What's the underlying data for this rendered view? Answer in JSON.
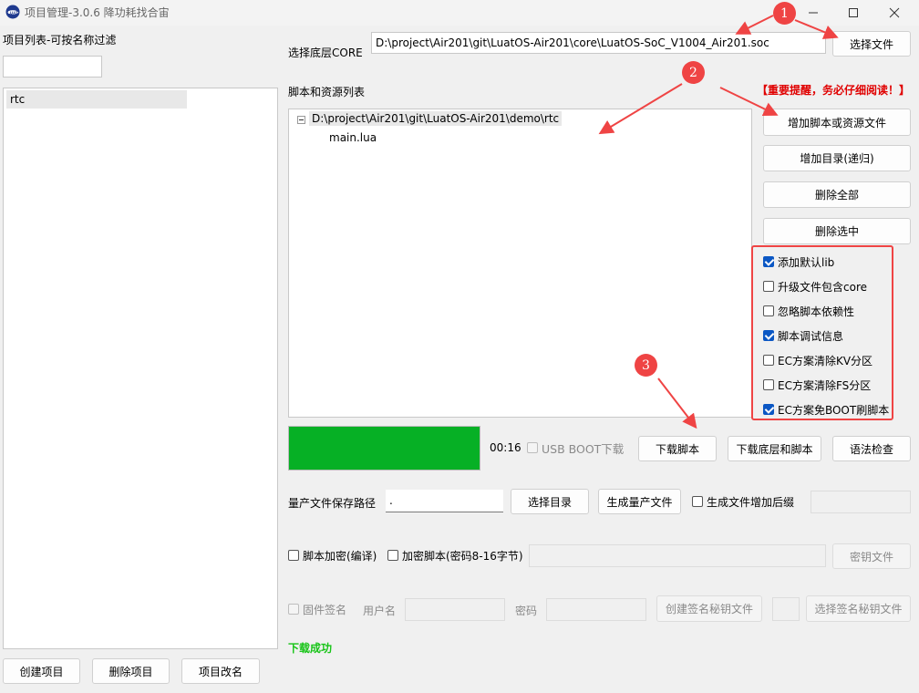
{
  "window": {
    "title": "项目管理-3.0.6 降功耗找合宙"
  },
  "left_panel": {
    "header": "项目列表-可按名称过滤",
    "filter_value": "",
    "projects": [
      "rtc"
    ],
    "buttons": {
      "create": "创建项目",
      "delete": "删除项目",
      "rename": "项目改名"
    }
  },
  "core": {
    "label": "选择底层CORE",
    "path": "D:\\project\\Air201\\git\\LuatOS-Air201\\core\\LuatOS-SoC_V1004_Air201.soc",
    "choose_button": "选择文件"
  },
  "scripts": {
    "label": "脚本和资源列表",
    "warning": "【重要提醒，务必仔细阅读！】",
    "tree_root": "D:\\project\\Air201\\git\\LuatOS-Air201\\demo\\rtc",
    "tree_children": [
      "main.lua"
    ],
    "buttons": {
      "add_files": "增加脚本或资源文件",
      "add_dir": "增加目录(递归)",
      "delete_all": "删除全部",
      "delete_selected": "删除选中"
    }
  },
  "options": [
    {
      "label": "添加默认lib",
      "checked": true
    },
    {
      "label": "升级文件包含core",
      "checked": false
    },
    {
      "label": "忽略脚本依赖性",
      "checked": false
    },
    {
      "label": "脚本调试信息",
      "checked": true
    },
    {
      "label": "EC方案清除KV分区",
      "checked": false
    },
    {
      "label": "EC方案清除FS分区",
      "checked": false
    },
    {
      "label": "EC方案免BOOT刷脚本",
      "checked": true
    }
  ],
  "download": {
    "progress": 1.0,
    "progress_color": "#06b025",
    "elapsed": "00:16",
    "usb_boot_label": "USB BOOT下载",
    "buttons": {
      "download_script": "下载脚本",
      "download_all": "下载底层和脚本",
      "syntax_check": "语法检查"
    }
  },
  "mass_production": {
    "label": "量产文件保存路径",
    "path_value": ".",
    "choose_dir": "选择目录",
    "generate": "生成量产文件",
    "suffix_label": "生成文件增加后缀"
  },
  "encryption": {
    "compile_encrypt": "脚本加密(编译)",
    "password_encrypt": "加密脚本(密码8-16字节)",
    "key_file_button": "密钥文件"
  },
  "signature": {
    "firmware_sign": "固件签名",
    "username_label": "用户名",
    "password_label": "密码",
    "create_key": "创建签名秘钥文件",
    "select_key": "选择签名秘钥文件"
  },
  "status": {
    "message": "下载成功",
    "color": "#17c417"
  },
  "annotations": {
    "color": "#ef4444",
    "markers": [
      "1",
      "2",
      "3"
    ]
  }
}
